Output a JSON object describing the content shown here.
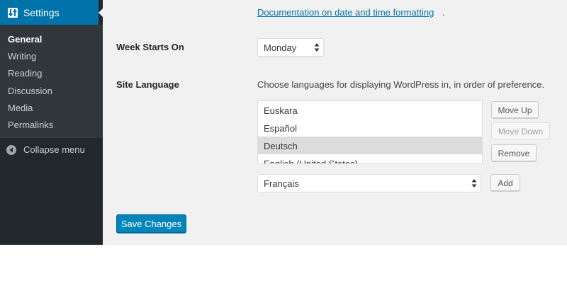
{
  "sidebar": {
    "settings_label": "Settings",
    "items": [
      {
        "label": "General",
        "active": true
      },
      {
        "label": "Writing"
      },
      {
        "label": "Reading"
      },
      {
        "label": "Discussion"
      },
      {
        "label": "Media"
      },
      {
        "label": "Permalinks"
      }
    ],
    "collapse_label": "Collapse menu"
  },
  "main": {
    "doc_link": "Documentation on date and time formatting",
    "doc_link_suffix": ".",
    "week_starts_label": "Week Starts On",
    "week_starts_value": "Monday",
    "site_language_label": "Site Language",
    "language_description": "Choose languages for displaying WordPress in, in order of preference.",
    "languages": [
      {
        "label": "Euskara"
      },
      {
        "label": "Español"
      },
      {
        "label": "Deutsch",
        "selected": true
      },
      {
        "label": "English (United States)"
      }
    ],
    "move_up_label": "Move Up",
    "move_down_label": "Move Down",
    "remove_label": "Remove",
    "add_language_value": "Français",
    "add_label": "Add",
    "save_label": "Save Changes"
  },
  "colors": {
    "admin_blue": "#0073aa",
    "sidebar_bg": "#23282d",
    "submenu_bg": "#32373c",
    "primary_button": "#0085ba"
  }
}
